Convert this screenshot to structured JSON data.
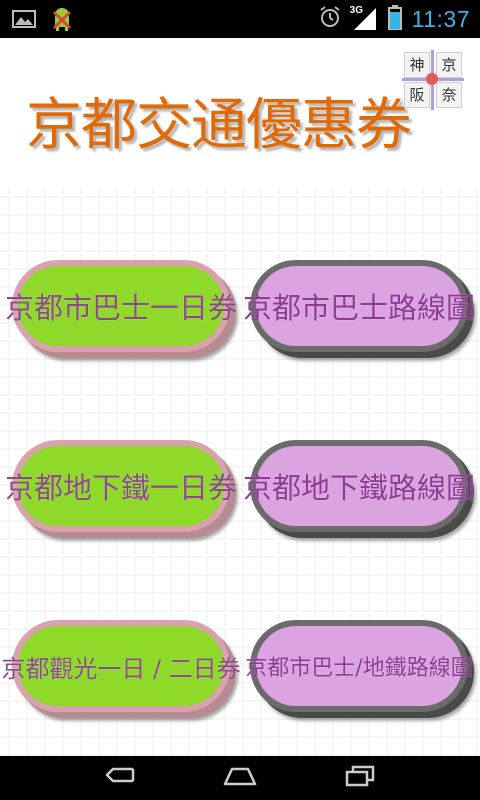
{
  "status_bar": {
    "time": "11:37",
    "network": "3G",
    "icons": [
      "gallery-icon",
      "android-debug-icon",
      "alarm-icon",
      "signal-icon",
      "battery-icon"
    ]
  },
  "app": {
    "title": "京都交通優惠券",
    "title_color": "#e06a08",
    "logo": {
      "cells": [
        "神",
        "京",
        "阪",
        "奈"
      ]
    }
  },
  "buttons": [
    {
      "label": "京都市巴士一日券",
      "style": "green"
    },
    {
      "label": "京都市巴士路線圖",
      "style": "pink"
    },
    {
      "label": "京都地下鐵一日券",
      "style": "green"
    },
    {
      "label": "京都地下鐵路線圖",
      "style": "pink"
    },
    {
      "label": "京都觀光一日 / 二日券",
      "style": "green"
    },
    {
      "label": "京都市巴士/地鐵路線圖",
      "style": "pink"
    }
  ],
  "colors": {
    "green_fill": "#8fd92a",
    "pink_fill": "#dba4e0",
    "accent_clock": "#33b5e5"
  },
  "nav_bar": {
    "buttons": [
      "back-icon",
      "home-icon",
      "recent-apps-icon"
    ]
  }
}
